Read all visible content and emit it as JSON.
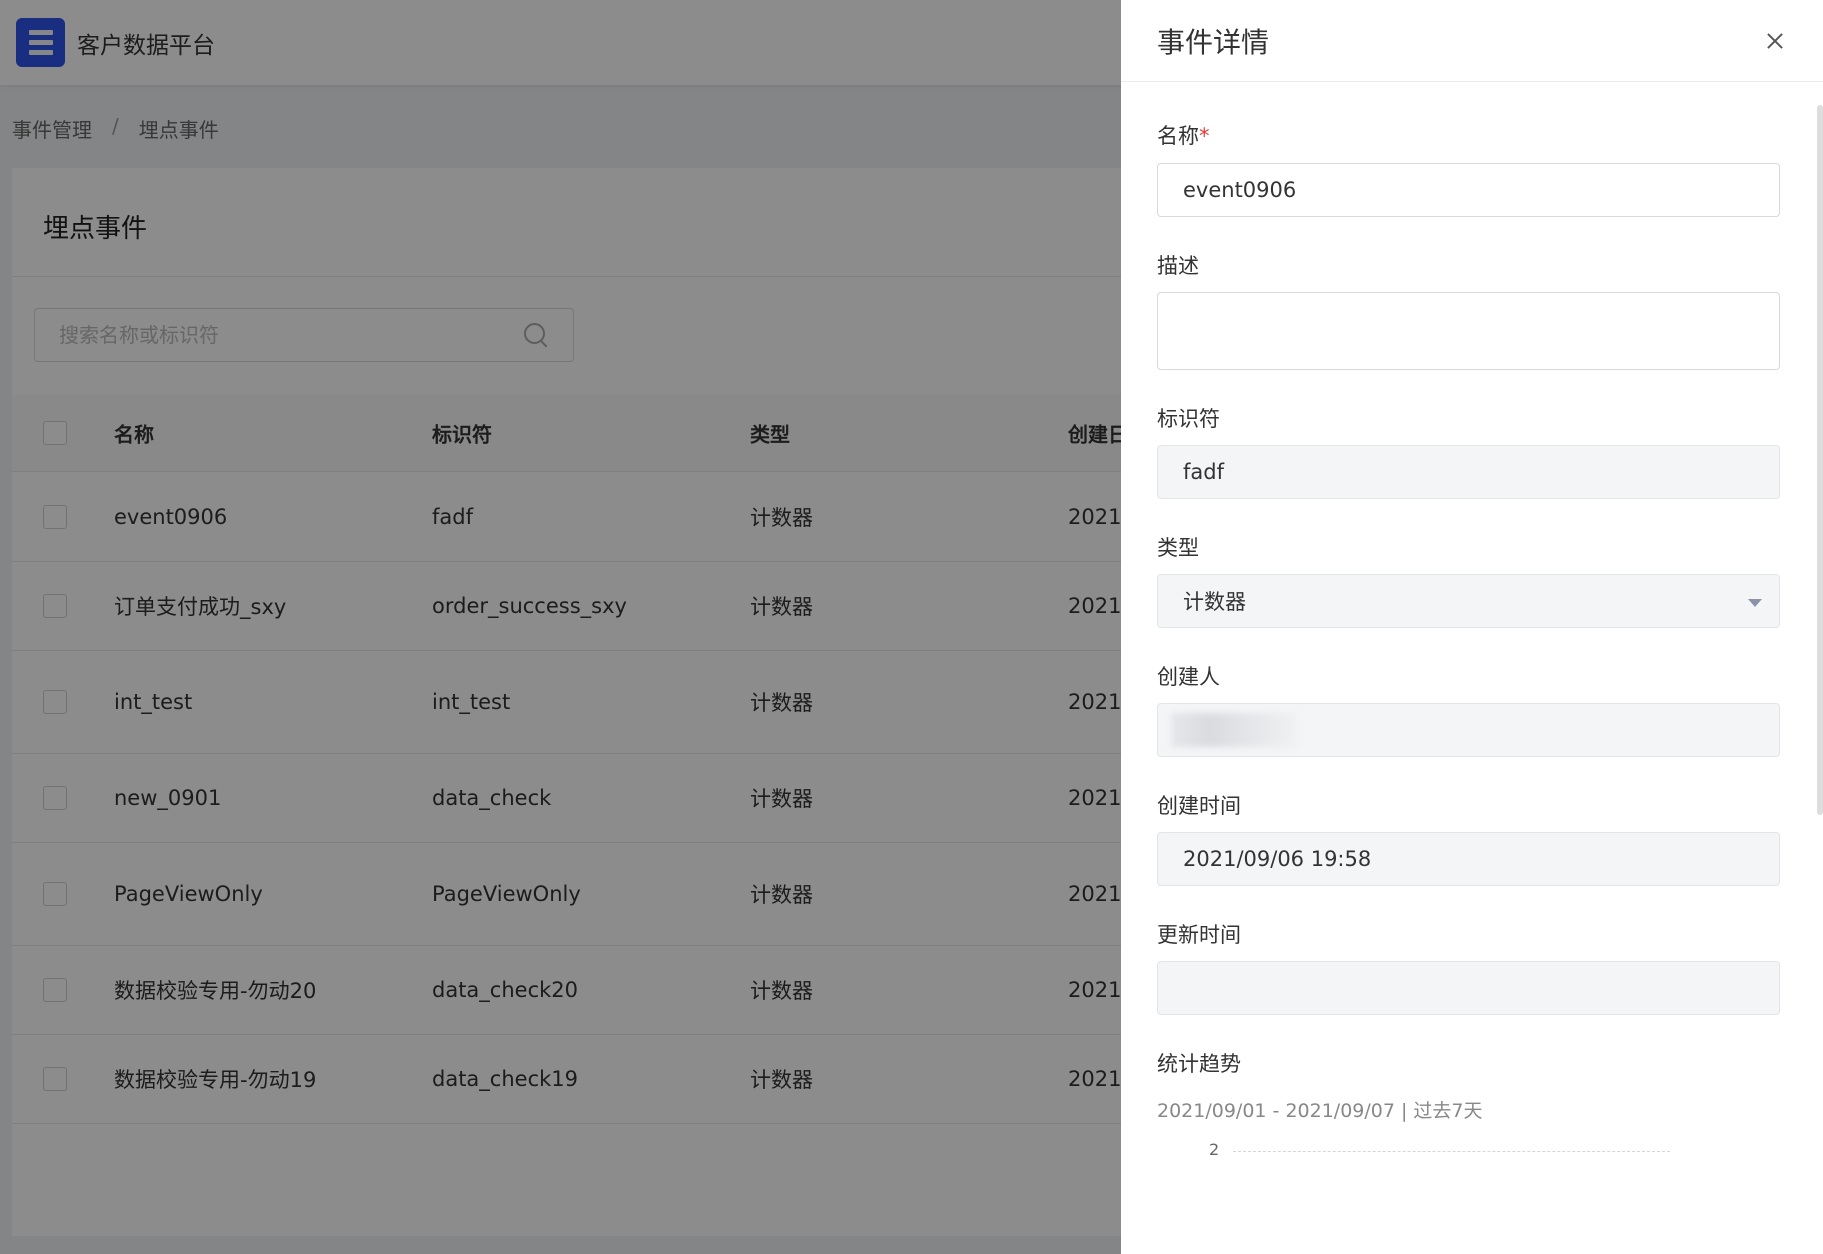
{
  "app": {
    "title": "客户数据平台"
  },
  "breadcrumb": {
    "items": [
      "事件管理",
      "埋点事件"
    ],
    "separator": "/"
  },
  "page": {
    "title": "埋点事件"
  },
  "search": {
    "placeholder": "搜索名称或标识符"
  },
  "table": {
    "columns": [
      "名称",
      "标识符",
      "类型",
      "创建日"
    ],
    "rows": [
      {
        "name": "event0906",
        "identifier": "fadf",
        "type": "计数器",
        "date": "2021/"
      },
      {
        "name": "订单支付成功_sxy",
        "identifier": "order_success_sxy",
        "type": "计数器",
        "date": "2021/"
      },
      {
        "name": "int_test",
        "identifier": "int_test",
        "type": "计数器",
        "date": "2021/"
      },
      {
        "name": "new_0901",
        "identifier": "data_check",
        "type": "计数器",
        "date": "2021/"
      },
      {
        "name": "PageViewOnly",
        "identifier": "PageViewOnly",
        "type": "计数器",
        "date": "2021/"
      },
      {
        "name": "数据校验专用-勿动20",
        "identifier": "data_check20",
        "type": "计数器",
        "date": "2021/"
      },
      {
        "name": "数据校验专用-勿动19",
        "identifier": "data_check19",
        "type": "计数器",
        "date": "2021/"
      }
    ]
  },
  "drawer": {
    "title": "事件详情",
    "fields": {
      "name": {
        "label": "名称",
        "required_mark": "*",
        "value": "event0906"
      },
      "description": {
        "label": "描述",
        "value": ""
      },
      "identifier": {
        "label": "标识符",
        "value": "fadf"
      },
      "type": {
        "label": "类型",
        "value": "计数器"
      },
      "creator": {
        "label": "创建人",
        "value": ""
      },
      "created_at": {
        "label": "创建时间",
        "value": "2021/09/06 19:58"
      },
      "updated_at": {
        "label": "更新时间",
        "value": ""
      }
    },
    "trend": {
      "label": "统计趋势",
      "range": "2021/09/01 - 2021/09/07 | 过去7天",
      "y_tick": "2"
    }
  },
  "colors": {
    "brand": "#2f54eb",
    "required": "#e53935",
    "mask": "rgba(0,0,0,0.45)"
  }
}
